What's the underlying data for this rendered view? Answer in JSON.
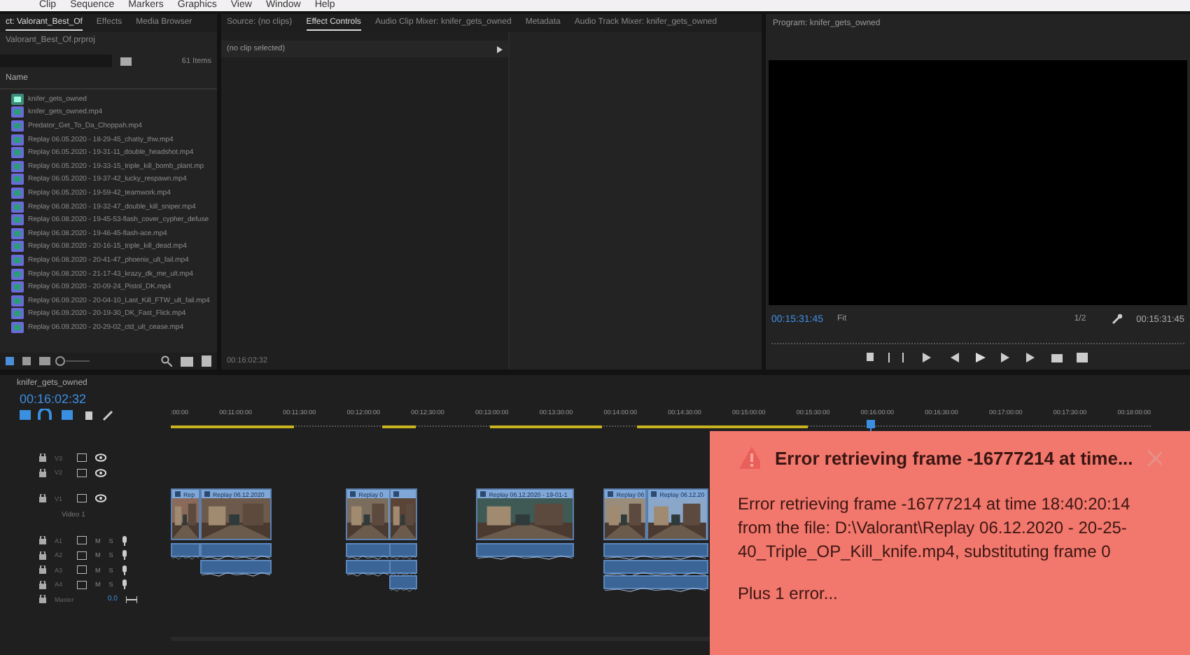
{
  "menu": [
    "Clip",
    "Sequence",
    "Markers",
    "Graphics",
    "View",
    "Window",
    "Help"
  ],
  "project": {
    "tabs": [
      {
        "label": "ct: Valorant_Best_Of",
        "selected": true
      },
      {
        "label": "Effects",
        "selected": false
      },
      {
        "label": "Media Browser",
        "selected": false
      }
    ],
    "file": "Valorant_Best_Of.prproj",
    "count": "61 Items",
    "column": "Name",
    "items": [
      {
        "name": "knifer_gets_owned",
        "kind": "sequence"
      },
      {
        "name": "knifer_gets_owned.mp4",
        "kind": "clip"
      },
      {
        "name": "Predator_Get_To_Da_Choppah.mp4",
        "kind": "clip"
      },
      {
        "name": "Replay 06.05.2020 - 18-29-45_chatty_thw.mp4",
        "kind": "clip"
      },
      {
        "name": "Replay 06.05.2020 - 19-31-11_double_headshot.mp4",
        "kind": "clip"
      },
      {
        "name": "Replay 06.05.2020 - 19-33-15_triple_kill_bomb_plant.mp",
        "kind": "clip"
      },
      {
        "name": "Replay 06.05.2020 - 19-37-42_lucky_respawn.mp4",
        "kind": "clip"
      },
      {
        "name": "Replay 06.05.2020 - 19-59-42_teamwork.mp4",
        "kind": "clip"
      },
      {
        "name": "Replay 06.08.2020 - 19-32-47_double_kill_sniper.mp4",
        "kind": "clip"
      },
      {
        "name": "Replay 06.08.2020 - 19-45-53-flash_cover_cypher_defuse",
        "kind": "clip"
      },
      {
        "name": "Replay 06.08.2020 - 19-46-45-flash-ace.mp4",
        "kind": "clip"
      },
      {
        "name": "Replay 06.08.2020 - 20-16-15_triple_kill_dead.mp4",
        "kind": "clip"
      },
      {
        "name": "Replay 06.08.2020 - 20-41-47_phoenix_ult_fail.mp4",
        "kind": "clip"
      },
      {
        "name": "Replay 06.08.2020 - 21-17-43_krazy_dk_me_ult.mp4",
        "kind": "clip"
      },
      {
        "name": "Replay 06.09.2020 - 20-09-24_Pistol_DK.mp4",
        "kind": "clip"
      },
      {
        "name": "Replay 06.09.2020 - 20-04-10_Last_Kill_FTW_ult_fail.mp4",
        "kind": "clip"
      },
      {
        "name": "Replay 06.09.2020 - 20-19-30_DK_Fast_Flick.mp4",
        "kind": "clip"
      },
      {
        "name": "Replay 06.09.2020 - 20-29-02_ctd_ult_cease.mp4",
        "kind": "clip"
      }
    ]
  },
  "source": {
    "tabs": [
      {
        "label": "Source: (no clips)",
        "selected": false
      },
      {
        "label": "Effect Controls",
        "selected": true
      },
      {
        "label": "Audio Clip Mixer: knifer_gets_owned",
        "selected": false
      },
      {
        "label": "Metadata",
        "selected": false
      },
      {
        "label": "Audio Track Mixer: knifer_gets_owned",
        "selected": false
      }
    ],
    "clip": "(no clip selected)",
    "timecode": "00:16:02:32"
  },
  "program": {
    "title": "Program: knifer_gets_owned",
    "timecode": "00:15:31:45",
    "zoom": "Fit",
    "resolution": "1/2",
    "duration": "00:15:31:45"
  },
  "timeline": {
    "title": "knifer_gets_owned",
    "timecode": "00:16:02:32",
    "ruler": [
      ":00:00",
      "00:11:00:00",
      "00:11:30:00",
      "00:12:00:00",
      "00:12:30:00",
      "00:13:00:00",
      "00:13:30:00",
      "00:14:00:00",
      "00:14:30:00",
      "00:15:00:00",
      "00:15:30:00",
      "00:16:00:00",
      "00:16:30:00",
      "00:17:00:00",
      "00:17:30:00",
      "00:18:00:00"
    ],
    "tracks": [
      {
        "kind": "video",
        "name": "V3"
      },
      {
        "kind": "video",
        "name": "V2"
      },
      {
        "kind": "video",
        "name": "V1",
        "label": "Video 1"
      },
      {
        "kind": "audio",
        "name": "A1",
        "mute": "M",
        "solo": "S"
      },
      {
        "kind": "audio",
        "name": "A2",
        "mute": "M",
        "solo": "S"
      },
      {
        "kind": "audio",
        "name": "A3",
        "mute": "M",
        "solo": "S"
      },
      {
        "kind": "audio",
        "name": "A4",
        "mute": "M",
        "solo": "S"
      },
      {
        "kind": "master",
        "name": "Master",
        "value": "0.0"
      }
    ],
    "clips": [
      {
        "kind": "video",
        "label": "Rep"
      },
      {
        "kind": "video",
        "label": "Replay 06.12.2020"
      },
      {
        "kind": "video",
        "label": "Replay 0"
      },
      {
        "kind": "video"
      },
      {
        "kind": "video",
        "label": "Replay 06.12.2020 - 19-01-1"
      },
      {
        "kind": "video",
        "label": "Replay 06"
      },
      {
        "kind": "video",
        "label": "Replay 06.12.20"
      }
    ]
  },
  "error": {
    "title": "Error retrieving frame -16777214 at time...",
    "message": "Error retrieving frame -16777214 at time 18:40:20:14 from the file: D:\\Valorant\\Replay 06.12.2020 - 20-25-40_Triple_OP_Kill_knife.mp4, substituting frame 0",
    "more": "Plus 1 error..."
  }
}
